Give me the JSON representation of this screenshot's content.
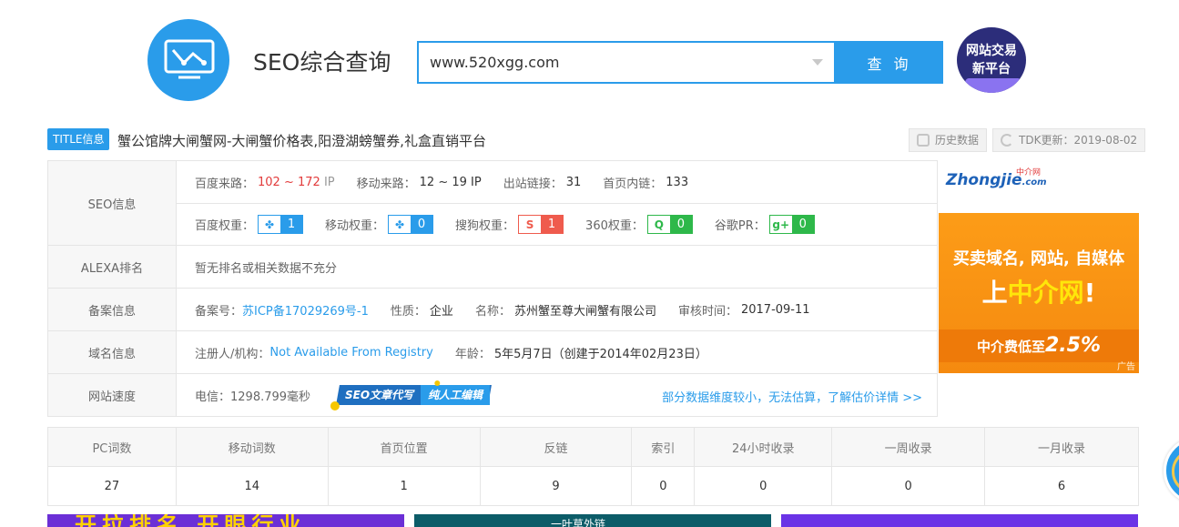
{
  "header": {
    "site_title": "SEO综合查询",
    "search_value": "www.520xgg.com",
    "search_button": "查 询",
    "trade_badge_line1": "网站交易",
    "trade_badge_line2": "新平台",
    "brand_color": "#2a9cea"
  },
  "title_bar": {
    "tag": "TITLE信息",
    "text": "蟹公馆牌大闸蟹网-大闸蟹价格表,阳澄湖螃蟹券,礼盒直销平台",
    "history_button": "历史数据",
    "tdk_button": "TDK更新：2019-08-02"
  },
  "seo": {
    "label": "SEO信息",
    "baidu_source_label": "百度来路：",
    "baidu_source_value": "102 ~ 172",
    "baidu_source_unit": "IP",
    "mobile_source_label": "移动来路：",
    "mobile_source_value": "12 ~ 19 IP",
    "outbound_label": "出站链接：",
    "outbound_value": "31",
    "inner_label": "首页内链：",
    "inner_value": "133",
    "baidu_weight_label": "百度权重：",
    "baidu_weight_value": "1",
    "mobile_weight_label": "移动权重：",
    "mobile_weight_value": "0",
    "sogou_weight_label": "搜狗权重：",
    "sogou_weight_value": "1",
    "weight_360_label": "360权重：",
    "weight_360_value": "0",
    "google_pr_label": "谷歌PR：",
    "google_pr_value": "0",
    "icons": [
      "baidu-paw-icon",
      "baidu-paw-icon",
      "sogou-s-icon",
      "360-q-icon",
      "google-plus-icon"
    ]
  },
  "alexa": {
    "label": "ALEXA排名",
    "text": "暂无排名或相关数据不充分"
  },
  "icp": {
    "label": "备案信息",
    "number_label": "备案号：",
    "number_value": "苏ICP备17029269号-1",
    "nature_label": "性质：",
    "nature_value": "企业",
    "name_label": "名称：",
    "name_value": "苏州蟹至尊大闸蟹有限公司",
    "audit_label": "审核时间：",
    "audit_value": "2017-09-11"
  },
  "domain": {
    "label": "域名信息",
    "registrant_label": "注册人/机构：",
    "registrant_value": "Not Available From Registry",
    "age_label": "年龄：",
    "age_value": "5年5月7日（创建于2014年02月23日）"
  },
  "speed": {
    "label": "网站速度",
    "telecom": "电信：1298.799毫秒",
    "ribbon_part1": "SEO文章代写",
    "ribbon_part2": "纯人工编辑",
    "estimate_link": "部分数据维度较小，无法估算，了解估价详情 >>"
  },
  "ad": {
    "logo": "Zhongjie",
    "logo_domain": ".com",
    "logo_cn": "中介网",
    "line1": "买卖域名, 网站, 自媒体",
    "line2_prefix": "上",
    "line2_highlight": "中介网",
    "line2_suffix": "!",
    "bottom_text": "中介费低至",
    "bottom_pct": "2.5%",
    "tag": "广告"
  },
  "stats": {
    "headers": [
      "PC词数",
      "移动词数",
      "首页位置",
      "反链",
      "索引",
      "24小时收录",
      "一周收录",
      "一月收录"
    ],
    "values": [
      "27",
      "14",
      "1",
      "9",
      "0",
      "0",
      "0",
      "6"
    ]
  },
  "banners": {
    "banner1_text": "开拉排名 开眼行业",
    "banner2_text": "一叶草外链"
  }
}
